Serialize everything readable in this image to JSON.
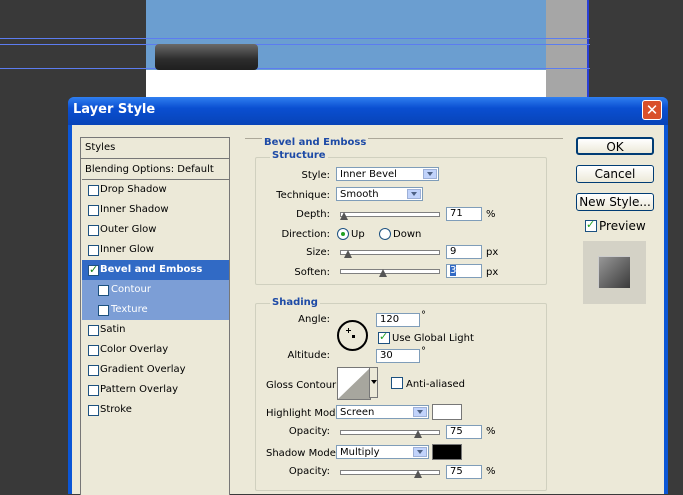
{
  "dialog": {
    "title": "Layer Style",
    "close_label": "✕"
  },
  "styles_panel": {
    "header": "Styles",
    "items": [
      {
        "label": "Blending Options: Default",
        "checkbox": false,
        "checked": false
      },
      {
        "label": "Drop Shadow",
        "checkbox": true,
        "checked": false
      },
      {
        "label": "Inner Shadow",
        "checkbox": true,
        "checked": false
      },
      {
        "label": "Outer Glow",
        "checkbox": true,
        "checked": false
      },
      {
        "label": "Inner Glow",
        "checkbox": true,
        "checked": false
      },
      {
        "label": "Bevel and Emboss",
        "checkbox": true,
        "checked": true,
        "selected": true
      },
      {
        "label": "Contour",
        "checkbox": true,
        "checked": false,
        "sub": true
      },
      {
        "label": "Texture",
        "checkbox": true,
        "checked": false,
        "sub": true
      },
      {
        "label": "Satin",
        "checkbox": true,
        "checked": false
      },
      {
        "label": "Color Overlay",
        "checkbox": true,
        "checked": false
      },
      {
        "label": "Gradient Overlay",
        "checkbox": true,
        "checked": false
      },
      {
        "label": "Pattern Overlay",
        "checkbox": true,
        "checked": false
      },
      {
        "label": "Stroke",
        "checkbox": true,
        "checked": false
      }
    ]
  },
  "bevel": {
    "section_title": "Bevel and Emboss",
    "structure": {
      "title": "Structure",
      "style_label": "Style:",
      "style_value": "Inner Bevel",
      "technique_label": "Technique:",
      "technique_value": "Smooth",
      "depth_label": "Depth:",
      "depth_value": "71",
      "depth_unit": "%",
      "depth_level": 0.0,
      "direction_label": "Direction:",
      "direction_up": "Up",
      "direction_down": "Down",
      "direction_selected": "Up",
      "size_label": "Size:",
      "size_value": "9",
      "size_unit": "px",
      "size_level": 0.04,
      "soften_label": "Soften:",
      "soften_value": "3",
      "soften_unit": "px",
      "soften_level": 0.4
    },
    "shading": {
      "title": "Shading",
      "angle_label": "Angle:",
      "angle_value": "120",
      "angle_unit": "°",
      "use_global_light_label": "Use Global Light",
      "use_global_light": true,
      "altitude_label": "Altitude:",
      "altitude_value": "30",
      "altitude_unit": "°",
      "gloss_contour_label": "Gloss Contour:",
      "anti_aliased_label": "Anti-aliased",
      "anti_aliased": false,
      "highlight_mode_label": "Highlight Mode:",
      "highlight_mode_value": "Screen",
      "highlight_color": "#ffffff",
      "highlight_opacity_label": "Opacity:",
      "highlight_opacity_value": "75",
      "highlight_opacity_unit": "%",
      "highlight_opacity_level": 0.75,
      "shadow_mode_label": "Shadow Mode:",
      "shadow_mode_value": "Multiply",
      "shadow_color": "#000000",
      "shadow_opacity_label": "Opacity:",
      "shadow_opacity_value": "75",
      "shadow_opacity_unit": "%",
      "shadow_opacity_level": 0.75
    }
  },
  "buttons": {
    "ok": "OK",
    "cancel": "Cancel",
    "new_style": "New Style...",
    "preview_label": "Preview",
    "preview_checked": true
  },
  "colors": {
    "title_bar": "#0a4fd1",
    "selected": "#316ac5",
    "sub_item": "#7c9ed6",
    "group_title": "#1d4aa6"
  }
}
